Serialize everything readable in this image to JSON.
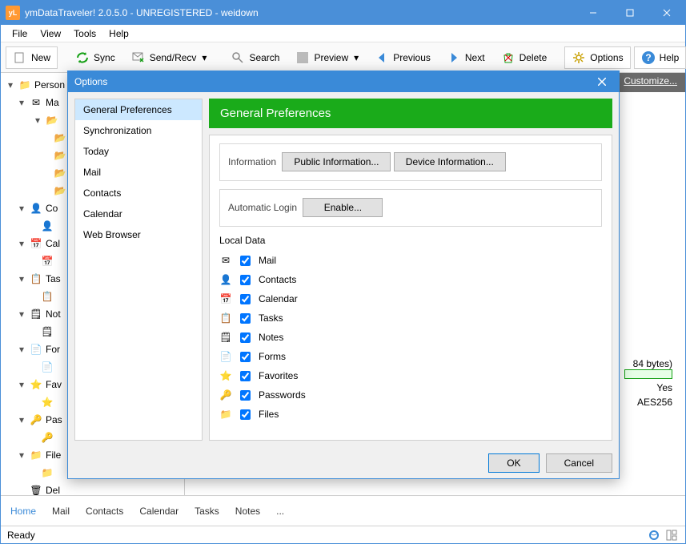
{
  "window": {
    "title": "ymDataTraveler! 2.0.5.0 - UNREGISTERED - weidown",
    "app_icon_text": "yL"
  },
  "menu": {
    "items": [
      "File",
      "View",
      "Tools",
      "Help"
    ]
  },
  "toolbar": {
    "new": "New",
    "sync": "Sync",
    "sendrecv": "Send/Recv",
    "search": "Search",
    "preview": "Preview",
    "previous": "Previous",
    "next": "Next",
    "delete": "Delete",
    "options": "Options",
    "help": "Help"
  },
  "tree": {
    "root": "Person",
    "main": "Ma",
    "items": [
      "Co",
      "Cal",
      "Tas",
      "Not",
      "For",
      "Fav",
      "Pas",
      "File",
      "Del"
    ]
  },
  "customize": "Customize...",
  "right_info": {
    "size": "84 bytes)",
    "yes": "Yes",
    "enc": "AES256"
  },
  "bottom_tabs": [
    "Home",
    "Mail",
    "Contacts",
    "Calendar",
    "Tasks",
    "Notes",
    "..."
  ],
  "status": {
    "ready": "Ready"
  },
  "dialog": {
    "title": "Options",
    "sidebar": [
      "General Preferences",
      "Synchronization",
      "Today",
      "Mail",
      "Contacts",
      "Calendar",
      "Web Browser"
    ],
    "header": "General Preferences",
    "information": {
      "legend": "Information",
      "public_btn": "Public Information...",
      "device_btn": "Device Information..."
    },
    "autologin": {
      "legend": "Automatic Login",
      "enable_btn": "Enable..."
    },
    "localdata": {
      "legend": "Local Data",
      "items": [
        {
          "label": "Mail",
          "checked": true,
          "icon": "mail"
        },
        {
          "label": "Contacts",
          "checked": true,
          "icon": "contacts"
        },
        {
          "label": "Calendar",
          "checked": true,
          "icon": "calendar"
        },
        {
          "label": "Tasks",
          "checked": true,
          "icon": "tasks"
        },
        {
          "label": "Notes",
          "checked": true,
          "icon": "notes"
        },
        {
          "label": "Forms",
          "checked": true,
          "icon": "forms"
        },
        {
          "label": "Favorites",
          "checked": true,
          "icon": "favorites"
        },
        {
          "label": "Passwords",
          "checked": true,
          "icon": "passwords"
        },
        {
          "label": "Files",
          "checked": true,
          "icon": "files"
        }
      ]
    },
    "ok": "OK",
    "cancel": "Cancel"
  }
}
